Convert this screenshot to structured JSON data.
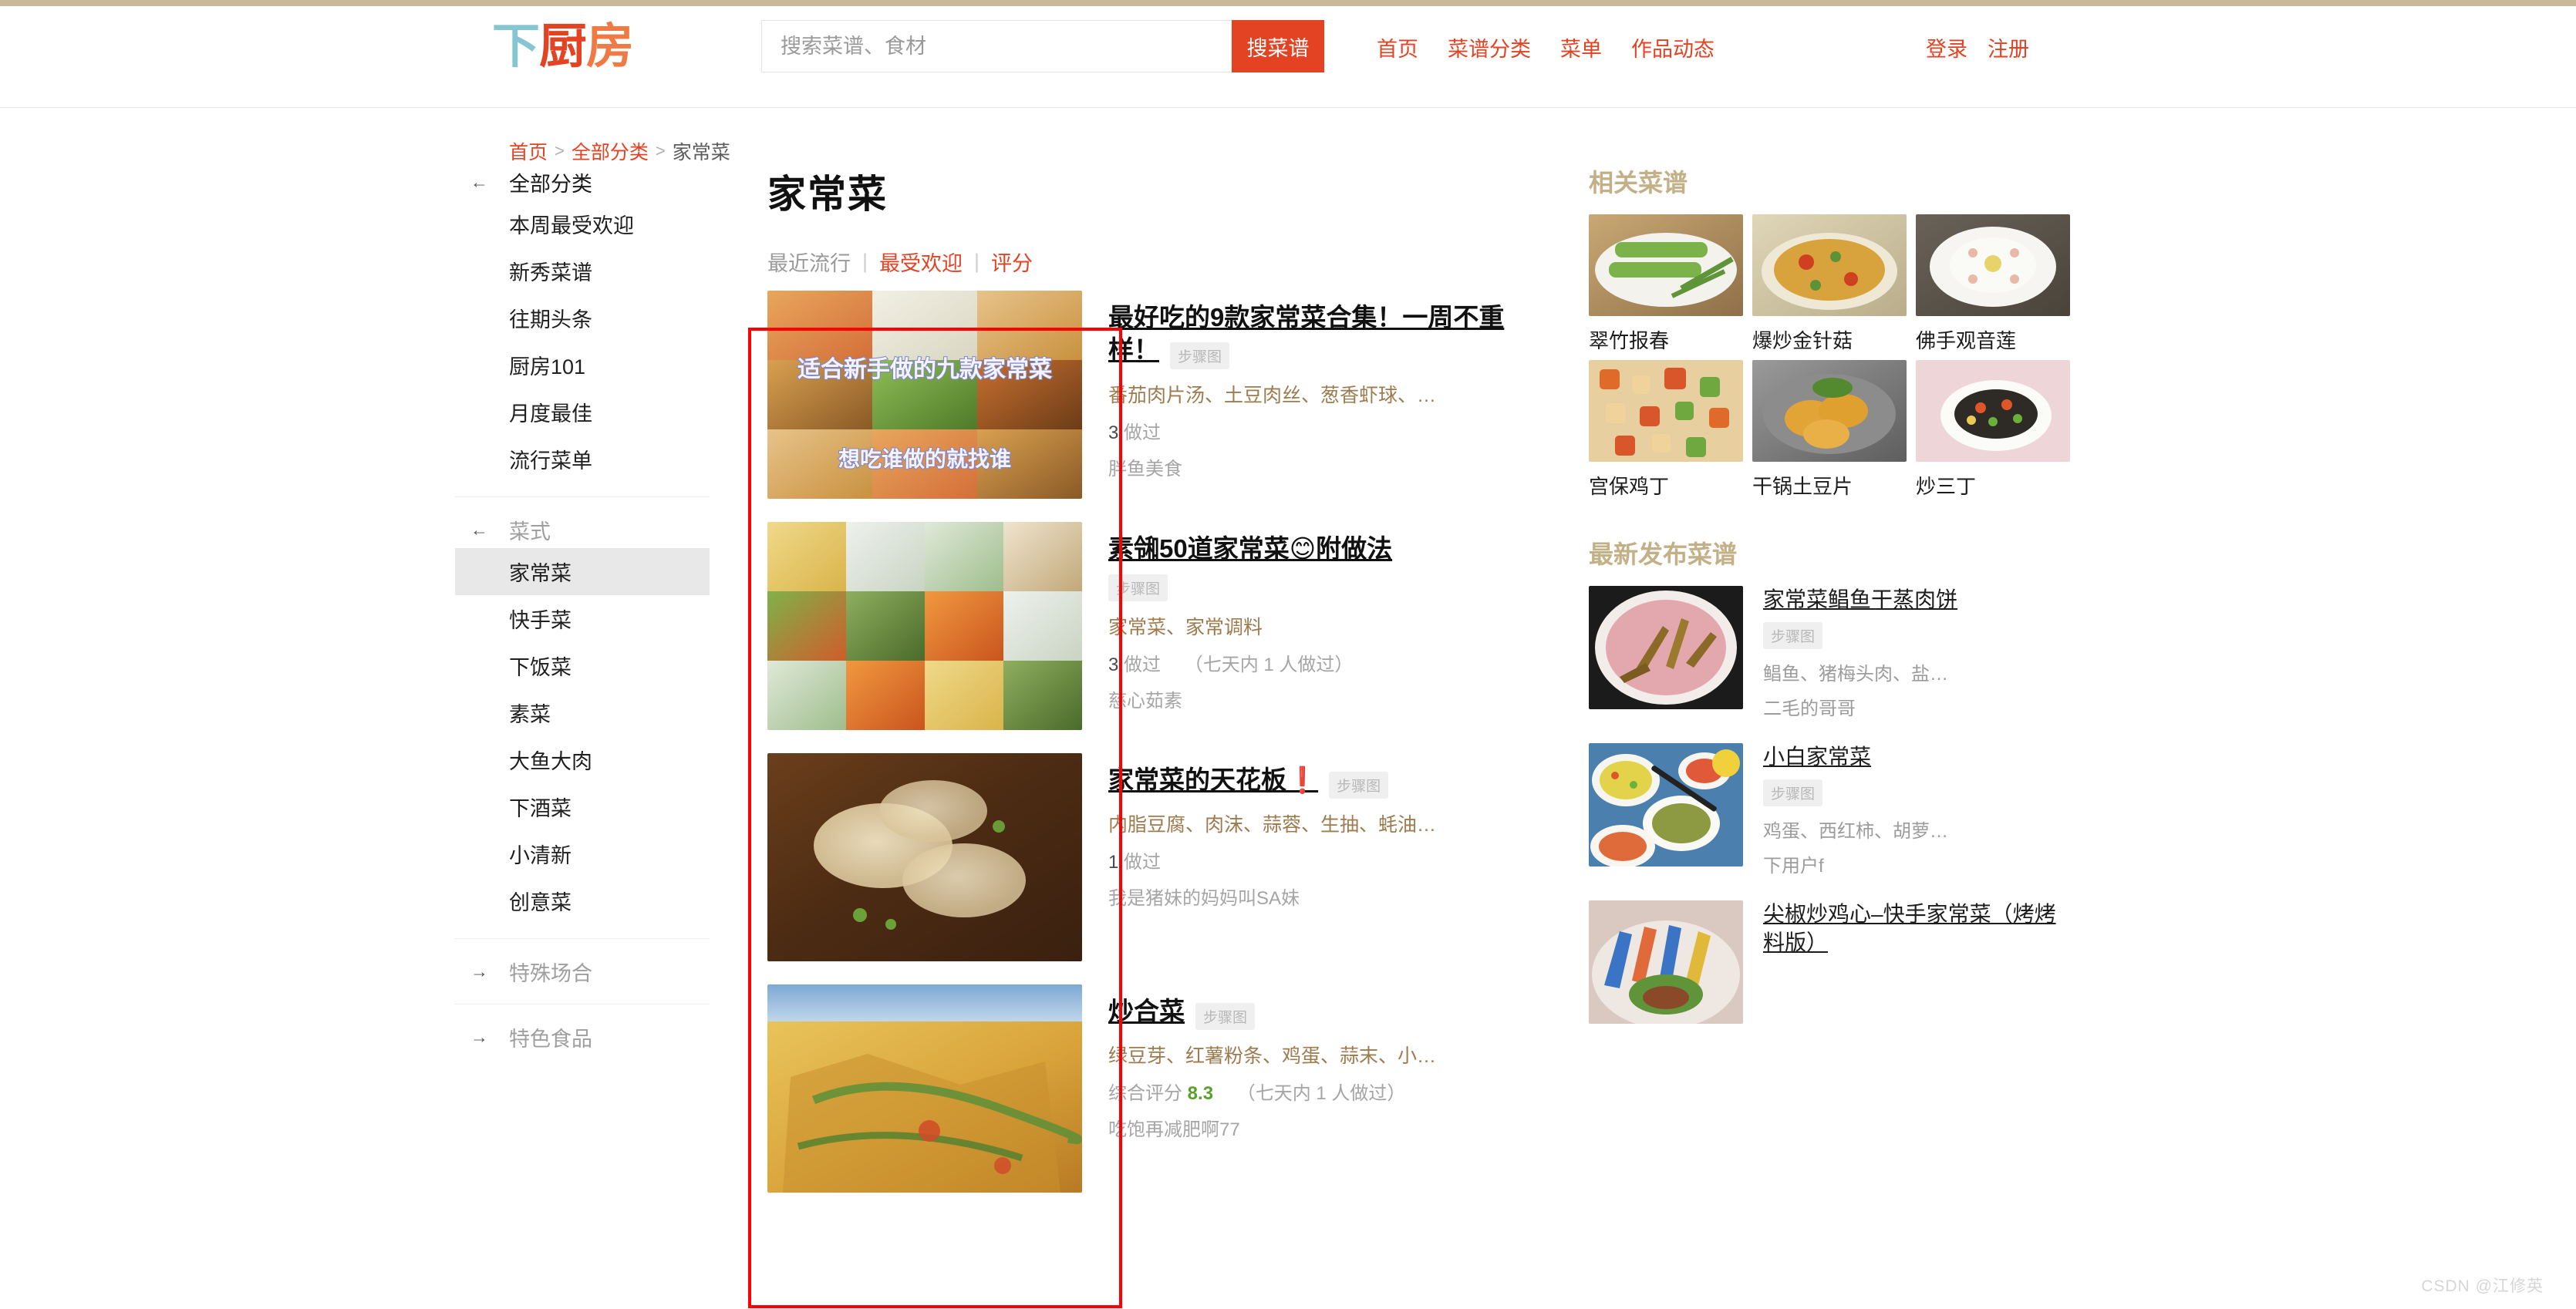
{
  "header": {
    "logo": {
      "char1": "下",
      "char2": "厨",
      "char3": "房"
    },
    "search": {
      "placeholder": "搜索菜谱、食材",
      "value": "",
      "button_label": "搜菜谱"
    },
    "nav": [
      {
        "label": "首页"
      },
      {
        "label": "菜谱分类"
      },
      {
        "label": "菜单"
      },
      {
        "label": "作品动态"
      }
    ],
    "user_nav": [
      {
        "label": "登录"
      },
      {
        "label": "注册"
      }
    ],
    "accent_color": "#e34323",
    "logo_colors": {
      "c1": "#86c6d1",
      "c2": "#e34323",
      "c3": "#f07a45"
    }
  },
  "breadcrumb": {
    "items": [
      {
        "label": "首页",
        "link": true
      },
      {
        "label": "全部分类",
        "link": true
      },
      {
        "label": "家常菜",
        "link": false
      }
    ],
    "separator": ">"
  },
  "sidebar": {
    "groups": [
      {
        "arrow": "←",
        "head": "全部分类",
        "head_muted": false,
        "items": [
          {
            "label": "本周最受欢迎",
            "active": false
          },
          {
            "label": "新秀菜谱",
            "active": false
          },
          {
            "label": "往期头条",
            "active": false
          },
          {
            "label": "厨房101",
            "active": false
          },
          {
            "label": "月度最佳",
            "active": false
          },
          {
            "label": "流行菜单",
            "active": false
          }
        ]
      },
      {
        "arrow": "←",
        "head": "菜式",
        "head_muted": true,
        "items": [
          {
            "label": "家常菜",
            "active": true
          },
          {
            "label": "快手菜",
            "active": false
          },
          {
            "label": "下饭菜",
            "active": false
          },
          {
            "label": "素菜",
            "active": false
          },
          {
            "label": "大鱼大肉",
            "active": false
          },
          {
            "label": "下酒菜",
            "active": false
          },
          {
            "label": "小清新",
            "active": false
          },
          {
            "label": "创意菜",
            "active": false
          }
        ]
      },
      {
        "arrow": "→",
        "head": "特殊场合",
        "head_muted": true,
        "items": []
      },
      {
        "arrow": "→",
        "head": "特色食品",
        "head_muted": true,
        "items": []
      }
    ]
  },
  "main": {
    "title": "家常菜",
    "sort_tabs": [
      {
        "label": "最近流行",
        "state": "current"
      },
      {
        "label": "最受欢迎",
        "state": "link"
      },
      {
        "label": "评分",
        "state": "link"
      }
    ],
    "tab_separator": "|",
    "step_badge": "步骤图",
    "recipes": [
      {
        "title": "最好吃的9款家常菜合集！一周不重样！",
        "badge": "步骤图",
        "ingredients": "番茄肉片汤、土豆肉丝、葱香虾球、…",
        "stat_count": "3",
        "stat_label": "做过",
        "stat_inner": "",
        "author": "胖鱼美食",
        "thumb_caption_top": "适合新手做的九款家常菜",
        "thumb_caption_bottom": "想吃谁做的就找谁"
      },
      {
        "title": "素㋿50道家常菜😊附做法",
        "badge": "步骤图",
        "ingredients": "家常菜、家常调料",
        "stat_count": "3",
        "stat_label": "做过",
        "stat_inner": "（七天内 1 人做过）",
        "author": "慈心茹素",
        "thumb_caption_top": "",
        "thumb_caption_bottom": ""
      },
      {
        "title": "家常菜的天花板❗",
        "badge": "步骤图",
        "ingredients": "内脂豆腐、肉沫、蒜蓉、生抽、蚝油…",
        "stat_count": "1",
        "stat_label": "做过",
        "stat_inner": "",
        "author": "我是猪妹的妈妈叫SA妹",
        "thumb_caption_top": "",
        "thumb_caption_bottom": ""
      },
      {
        "title": "炒合菜",
        "badge": "步骤图",
        "ingredients": "绿豆芽、红薯粉条、鸡蛋、蒜末、小…",
        "score_label": "综合评分",
        "score": "8.3",
        "stat_inner": "（七天内 1 人做过）",
        "author": "吃饱再减肥啊77",
        "thumb_caption_top": "",
        "thumb_caption_bottom": ""
      }
    ]
  },
  "right": {
    "related_title": "相关菜谱",
    "related": [
      {
        "name": "翠竹报春"
      },
      {
        "name": "爆炒金针菇"
      },
      {
        "name": "佛手观音莲"
      },
      {
        "name": "宫保鸡丁"
      },
      {
        "name": "干锅土豆片"
      },
      {
        "name": "炒三丁"
      }
    ],
    "latest_title": "最新发布菜谱",
    "latest": [
      {
        "title": "家常菜鲳鱼干蒸肉饼",
        "badge": "步骤图",
        "ingredients": "鲳鱼、猪梅头肉、盐…",
        "author": "二毛的哥哥"
      },
      {
        "title": "小白家常菜",
        "badge": "步骤图",
        "ingredients": "鸡蛋、西红柿、胡萝…",
        "author": "下用户f"
      },
      {
        "title": "尖椒炒鸡心–快手家常菜（烤烤料版）",
        "badge": "",
        "ingredients": "",
        "author": ""
      }
    ]
  },
  "watermark": "CSDN @江修英"
}
